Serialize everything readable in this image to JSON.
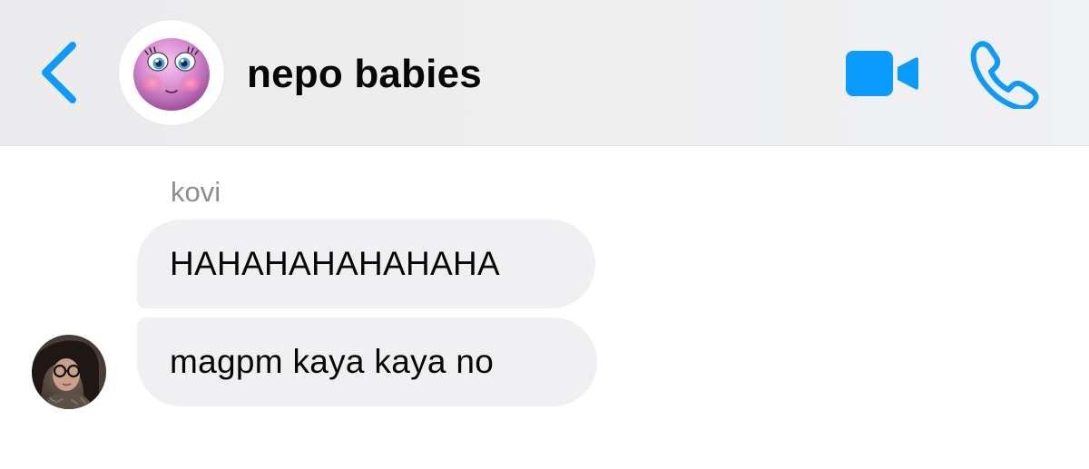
{
  "header": {
    "title": "nepo babies",
    "back_icon": "chevron-left-icon",
    "video_icon": "video-camera-icon",
    "call_icon": "phone-icon",
    "accent_color": "#0a9bff"
  },
  "conversation": {
    "sender_name": "kovi",
    "messages": [
      {
        "text": "HAHAHAHAHAHAHA"
      },
      {
        "text": "magpm kaya kaya no"
      }
    ]
  }
}
